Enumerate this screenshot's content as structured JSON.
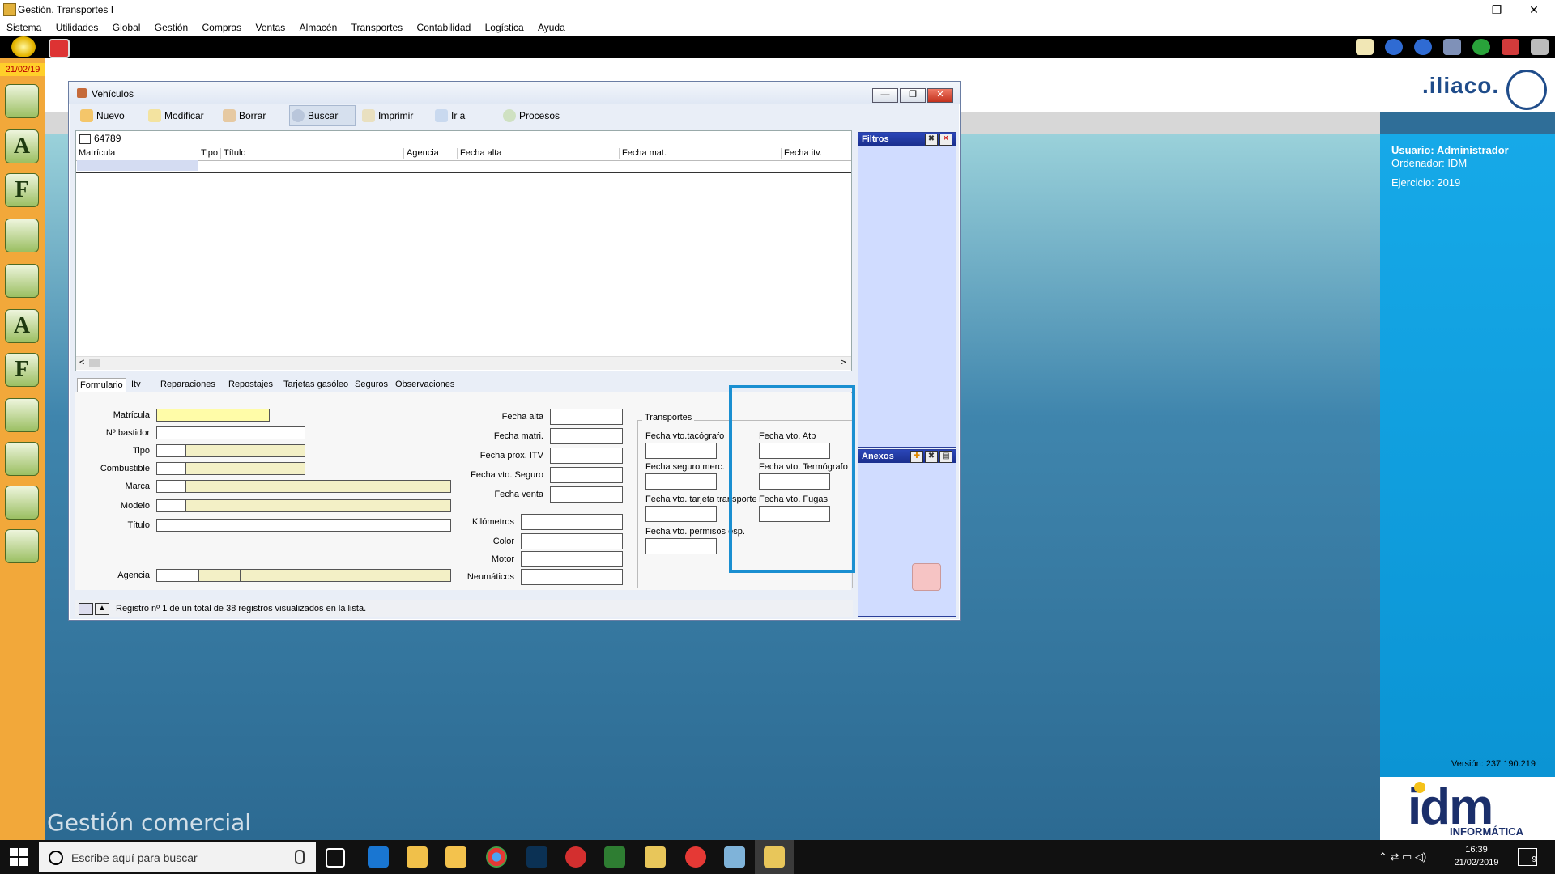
{
  "window": {
    "title": "Gestión. Transportes I",
    "minimize": "—",
    "maximize": "❐",
    "close": "✕"
  },
  "menu": [
    "Sistema",
    "Utilidades",
    "Global",
    "Gestión",
    "Compras",
    "Ventas",
    "Almacén",
    "Transportes",
    "Contabilidad",
    "Logística",
    "Ayuda"
  ],
  "leftbar": {
    "date": "21/02/19",
    "letters": [
      "",
      "A",
      "F",
      "",
      "",
      "A",
      "F",
      "",
      "",
      "",
      ""
    ]
  },
  "desktop": {
    "brand_text": "Gestión comercial",
    "logo_text": ".iliaco."
  },
  "info": {
    "usuario": "Usuario: Administrador",
    "ordenador": "Ordenador: IDM",
    "ejercicio": "Ejercicio: 2019",
    "version": "Versión: 237 190.219",
    "idm": "idm",
    "idm_sub": "INFORMÁTICA"
  },
  "vehiculos": {
    "title": "Vehículos",
    "win_min": "—",
    "win_max": "❐",
    "win_close": "✕",
    "toolbar": [
      "Nuevo",
      "Modificar",
      "Borrar",
      "Buscar",
      "Imprimir",
      "Ir a",
      "Procesos"
    ],
    "search_value": "64789",
    "columns": [
      "Matrícula",
      "Tipo",
      "Título",
      "Agencia",
      "Fecha alta",
      "Fecha mat.",
      "Fecha itv."
    ],
    "scroll_left": "<",
    "scroll_right": ">",
    "filtros_title": "Filtros",
    "anexos_title": "Anexos",
    "tabs": [
      "Formulario",
      "Itv",
      "Reparaciones",
      "Repostajes",
      "Tarjetas gasóleo",
      "Seguros",
      "Observaciones"
    ],
    "form_left": [
      "Matrícula",
      "Nº bastidor",
      "Tipo",
      "Combustible",
      "Marca",
      "Modelo",
      "Título",
      "Agencia"
    ],
    "form_mid": [
      "Fecha alta",
      "Fecha matri.",
      "Fecha prox. ITV",
      "Fecha vto. Seguro",
      "Fecha venta",
      "Kilómetros",
      "Color",
      "Motor",
      "Neumáticos"
    ],
    "transportes_title": "Transportes",
    "transportes": [
      "Fecha vto.tacógrafo",
      "Fecha seguro merc.",
      "Fecha vto. tarjeta transporte",
      "Fecha vto. permisos esp.",
      "Fecha vto. Atp",
      "Fecha vto. Termógrafo",
      "Fecha vto. Fugas"
    ],
    "status": "Registro nº 1 de un total de 38 registros visualizados en la lista."
  },
  "taskbar": {
    "search_placeholder": "Escribe aquí para buscar",
    "time": "16:39",
    "date": "21/02/2019",
    "notifications": "9"
  }
}
